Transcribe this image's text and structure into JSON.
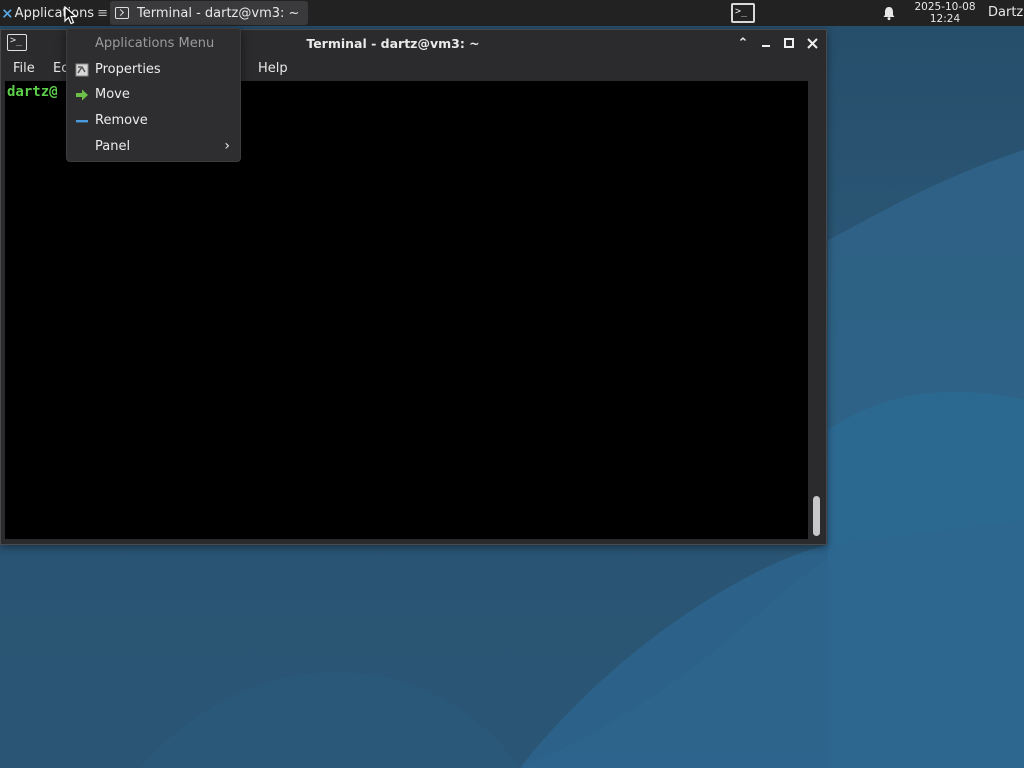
{
  "top_panel": {
    "applications_label": "Applications",
    "applications_icon": "xfce-logo-icon",
    "applications_trailing": "≡",
    "task_label": "Terminal - dartz@vm3: ~",
    "task_icon": "terminal-icon",
    "launcher_icon": "terminal-launcher-icon",
    "notification_icon": "bell-icon",
    "clock_date": "2025-10-08",
    "clock_time": "12:24",
    "user_label": "Dartz"
  },
  "window": {
    "title": "Terminal - dartz@vm3: ~",
    "icon": "terminal-icon",
    "controls": [
      "maximize-up-icon",
      "minimize-icon",
      "maximize-icon",
      "close-icon"
    ],
    "menubar": [
      {
        "label": "File"
      },
      {
        "label": "Ec"
      },
      {
        "label": "Help"
      }
    ],
    "terminal_prompt": "dartz@"
  },
  "context_menu": {
    "header": "Applications Menu",
    "items": [
      {
        "label": "Properties",
        "icon": "properties-icon"
      },
      {
        "label": "Move",
        "icon": "move-arrow-icon"
      },
      {
        "label": "Remove",
        "icon": "remove-icon"
      },
      {
        "label": "Panel",
        "icon": "chevron-right-icon",
        "submenu": true
      }
    ]
  },
  "colors": {
    "panel_bg": "#222223",
    "window_bg": "#2b2b2d",
    "terminal_bg": "#000000",
    "prompt_green": "#5cd04a",
    "desktop_blue": "#2d5a7a",
    "move_icon_green": "#6cc04a",
    "remove_icon_blue": "#4a9be0"
  }
}
